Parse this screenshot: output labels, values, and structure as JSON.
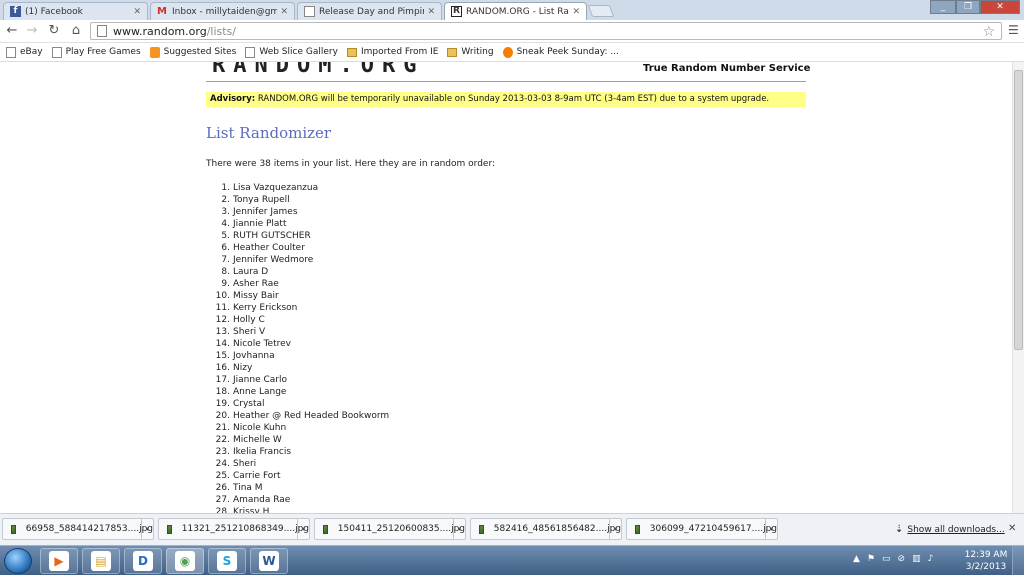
{
  "tabs": [
    {
      "label": "(1) Facebook",
      "icon": "facebook-icon",
      "color": "#3b5998"
    },
    {
      "label": "Inbox - millytaiden@gmai",
      "icon": "gmail-icon",
      "color": "#d93025"
    },
    {
      "label": "Release Day and Pimpin' C",
      "icon": "page-icon",
      "color": "#888888"
    },
    {
      "label": "RANDOM.ORG - List Rand",
      "icon": "random-org-icon",
      "color": "#222222"
    }
  ],
  "address": {
    "host": "www.random.org",
    "path": "/lists/"
  },
  "bookmarks": [
    {
      "label": "eBay",
      "icon": "page-icon"
    },
    {
      "label": "Play Free Games",
      "icon": "page-icon"
    },
    {
      "label": "Suggested Sites",
      "icon": "suggested-sites-icon"
    },
    {
      "label": "Web Slice Gallery",
      "icon": "page-icon"
    },
    {
      "label": "Imported From IE",
      "icon": "folder-icon"
    },
    {
      "label": "Writing",
      "icon": "folder-icon"
    },
    {
      "label": "Sneak Peek Sunday: ...",
      "icon": "blogger-icon"
    }
  ],
  "site": {
    "logo": "RANDOM.ORG",
    "tagline": "True Random Number Service",
    "advisory_label": "Advisory:",
    "advisory_text": "RANDOM.ORG will be temporarily unavailable on Sunday 2013-03-03 8-9am UTC (3-4am EST) due to a system upgrade."
  },
  "page": {
    "title": "List Randomizer",
    "intro": "There were 38 items in your list. Here they are in random order:",
    "items": [
      "Lisa Vazquezanzua",
      "Tonya Rupell",
      "Jennifer James",
      "Jiannie Platt",
      "RUTH GUTSCHER",
      "Heather Coulter",
      "Jennifer Wedmore",
      "Laura D",
      "Asher Rae",
      "Missy Bair",
      "Kerry Erickson",
      "Holly C",
      "Sheri V",
      "Nicole Tetrev",
      "Jovhanna",
      "Nizy",
      "Jianne Carlo",
      "Anne Lange",
      "Crystal",
      "Heather @ Red Headed Bookworm",
      "Nicole Kuhn",
      "Michelle W",
      "Ikelia Francis",
      "Sheri",
      "Carrie Fort",
      "Tina M",
      "Amanda Rae",
      "Krissy H"
    ]
  },
  "downloads": {
    "items": [
      "66958_588414217853....jpg",
      "11321_251210868349....jpg",
      "150411_25120600835....jpg",
      "582416_48561856482....jpg",
      "306099_47210459617....jpg"
    ],
    "show_all": "Show all downloads..."
  },
  "taskbar": {
    "apps": [
      {
        "name": "media-player-icon",
        "glyph": "▶"
      },
      {
        "name": "file-explorer-icon",
        "glyph": "▤"
      },
      {
        "name": "dell-icon",
        "glyph": "D"
      },
      {
        "name": "chrome-icon",
        "glyph": "◉"
      },
      {
        "name": "skype-icon",
        "glyph": "S"
      },
      {
        "name": "word-icon",
        "glyph": "W"
      }
    ],
    "time": "12:39 AM",
    "date": "3/2/2013"
  }
}
